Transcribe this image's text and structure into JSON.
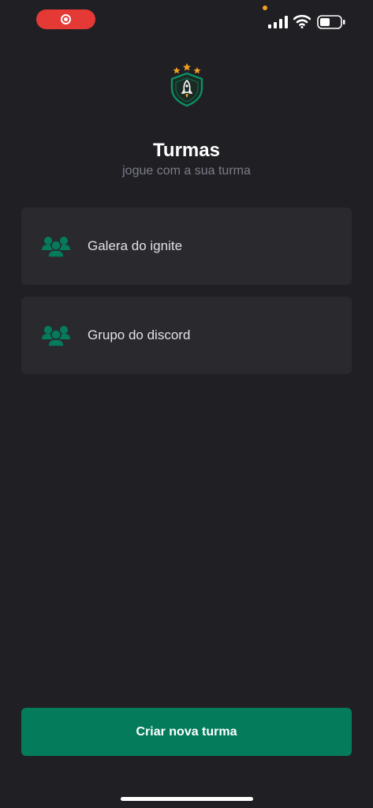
{
  "header": {
    "title": "Turmas",
    "subtitle": "jogue com a sua turma"
  },
  "groups": [
    {
      "label": "Galera do ignite",
      "icon": "users-three-icon"
    },
    {
      "label": "Grupo do discord",
      "icon": "users-three-icon"
    }
  ],
  "actions": {
    "create_label": "Criar nova turma"
  },
  "icons": {
    "logo": "shield-rocket-logo",
    "record": "screen-record-icon",
    "signal": "cellular-signal-icon",
    "wifi": "wifi-icon",
    "battery": "battery-icon"
  },
  "colors": {
    "background": "#202024",
    "card": "#29292e",
    "accent": "#047c5c",
    "star": "#f5a020",
    "record": "#e53935",
    "subtitle": "#7c7c8a"
  }
}
